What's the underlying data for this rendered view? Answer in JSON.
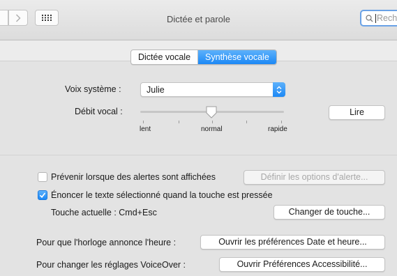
{
  "window": {
    "title": "Dictée et parole",
    "search_placeholder": "Rech"
  },
  "tabs": [
    {
      "label": "Dictée vocale",
      "selected": false
    },
    {
      "label": "Synthèse vocale",
      "selected": true
    }
  ],
  "voice": {
    "label": "Voix système :",
    "value": "Julie"
  },
  "rate": {
    "label": "Débit vocal :",
    "ticks": [
      "lent",
      "normal",
      "rapide"
    ],
    "play_button": "Lire",
    "level": 0.5
  },
  "alerts": {
    "checkbox_label": "Prévenir lorsque des alertes sont affichées",
    "checked": false,
    "options_button": "Définir les options d'alerte..."
  },
  "selection": {
    "checkbox_label": "Énoncer le texte sélectionné quand la touche est pressée",
    "checked": true,
    "current_key": "Touche actuelle : Cmd+Esc",
    "change_button": "Changer de touche..."
  },
  "clock": {
    "label": "Pour que l'horloge annonce l'heure :",
    "button": "Ouvrir les préférences Date et heure..."
  },
  "voiceover": {
    "label": "Pour changer les réglages VoiceOver :",
    "button": "Ouvrir Préférences Accessibilité..."
  },
  "colors": {
    "accent": "#1c88f5",
    "search_focus": "#6aa2e6"
  }
}
